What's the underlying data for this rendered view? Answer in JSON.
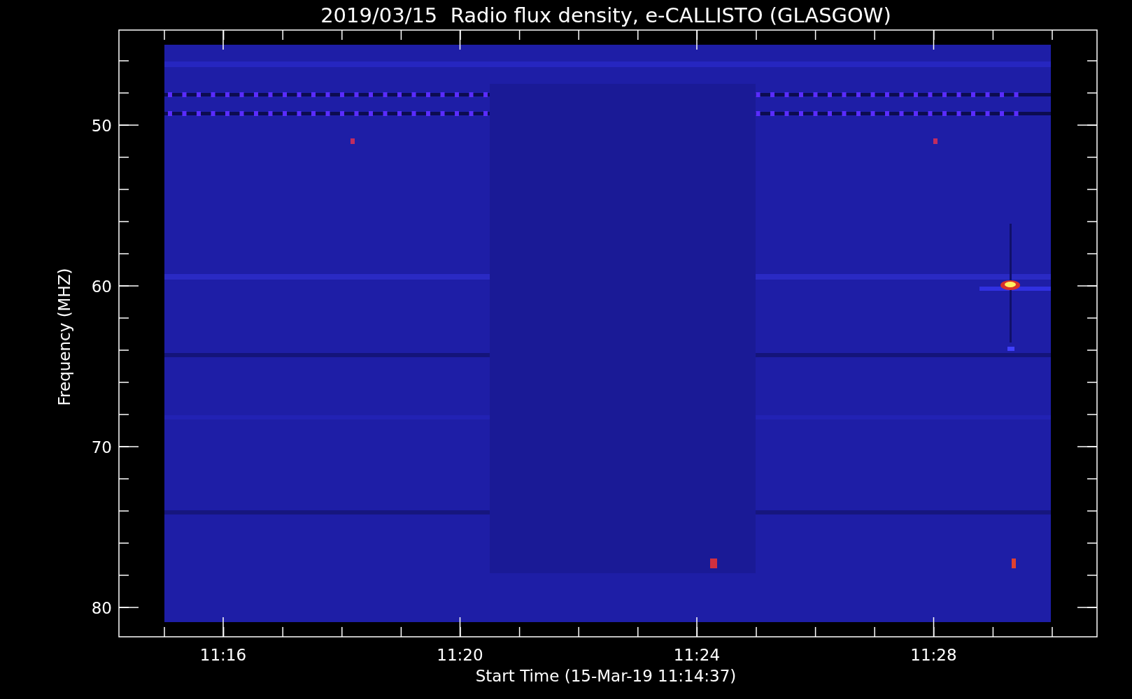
{
  "title": "2019/03/15  Radio flux density, e-CALLISTO (GLASGOW)",
  "y_axis": {
    "label": "Frequency (MHZ)",
    "ticks": [
      "50",
      "60",
      "70",
      "80"
    ]
  },
  "x_axis": {
    "label": "Start Time (15-Mar-19 11:14:37)",
    "ticks": [
      "11:16",
      "11:20",
      "11:24",
      "11:28"
    ]
  }
}
